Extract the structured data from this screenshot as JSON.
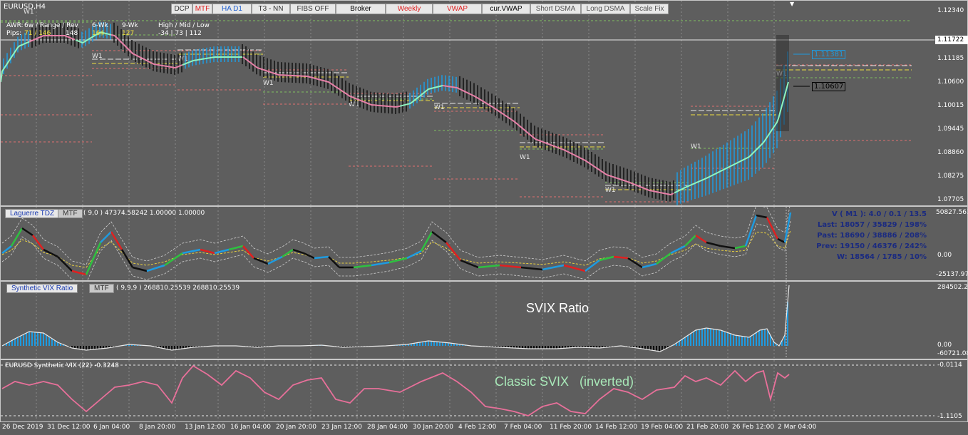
{
  "symbol_label": "EURUSD,H4",
  "toolbar": [
    {
      "label": "DCP",
      "color": "#333"
    },
    {
      "label": "MTF",
      "color": "#e02020"
    },
    {
      "label": "HA D1",
      "color": "#2060d0"
    },
    {
      "label": "T3 - NN",
      "color": "#333"
    },
    {
      "label": "FIBS OFF",
      "color": "#333"
    },
    {
      "label": "Broker",
      "color": "#000"
    },
    {
      "label": "Weekly",
      "color": "#e02020"
    },
    {
      "label": "VWAP",
      "color": "#e02020"
    },
    {
      "label": "cur.VWAP",
      "color": "#000"
    },
    {
      "label": "Short DSMA",
      "color": "#555"
    },
    {
      "label": "Long DSMA",
      "color": "#555"
    },
    {
      "label": "Scale Fix",
      "color": "#555"
    }
  ],
  "awr": {
    "header_awr": "AWR:",
    "header_range": "6w / Range / Rev",
    "header_6wk": "6-Wk",
    "header_9wk": "9-Wk",
    "header_hml": "High / Mid / Low",
    "pips_label": "Pips:",
    "pips_range": "71 / 146",
    "pips_rev": "148",
    "v6wk": "164",
    "v9wk": "127",
    "hml": "-34  |  73  |  112"
  },
  "price_axis": [
    "1.12340",
    "1.11722",
    "1.11185",
    "1.10600",
    "1.10015",
    "1.09445",
    "1.08860",
    "1.08275",
    "1.07705"
  ],
  "price_markers": {
    "upper": "1.11381",
    "lower": "1.10607"
  },
  "week_marks": [
    "W1",
    "W1",
    "W1",
    "W1",
    "W1",
    "W1",
    "W1",
    "W1",
    "W1",
    "W1"
  ],
  "laguerre": {
    "title_button": "Laguerre TDZ",
    "mtf_button": "MTF",
    "params": "( 9,0 ) 47374.58242 1.00000 1.00000",
    "axis": [
      "50827.561",
      "0.00",
      "-25137.97"
    ],
    "stats": [
      "V ( M1 ): 4.0 / 0.1 / 13.5",
      "Last: 18057 / 35829 / 198%",
      "Past: 18690 / 38886 / 208%",
      "Prev: 19150 / 46376 / 242%",
      "W: 18564 / 1785 / 10%"
    ]
  },
  "svix": {
    "title_button": "Synthetic VIX Ratio",
    "mtf_button": "MTF",
    "params": "( 9,9,9 ) 268810.25539 268810.25539",
    "caption": "SVIX Ratio",
    "axis": [
      "284502.22",
      "0.00",
      "-60721.08"
    ]
  },
  "classic": {
    "label": "EURUSD Synthetic VIX (22) -0.3248",
    "caption": "Classic SVIX   (inverted)",
    "axis": [
      "-0.0114",
      "-1.1105"
    ]
  },
  "dates": [
    "26 Dec 2019",
    "31 Dec 12:00",
    "6 Jan 04:00",
    "8 Jan 20:00",
    "13 Jan 12:00",
    "16 Jan 04:00",
    "20 Jan 20:00",
    "23 Jan 12:00",
    "28 Jan 04:00",
    "30 Jan 20:00",
    "4 Feb 12:00",
    "7 Feb 04:00",
    "11 Feb 20:00",
    "14 Feb 12:00",
    "19 Feb 04:00",
    "21 Feb 20:00",
    "26 Feb 12:00",
    "2 Mar 04:00"
  ],
  "colors": {
    "bg": "#5e5e5e",
    "ha_up": "#1e9be0",
    "ha_down": "#101010",
    "ma_up": "#8ef5c0",
    "ma_down": "#e880a8",
    "classic": "#e8709a",
    "caption_green": "#a8e8b8"
  }
}
